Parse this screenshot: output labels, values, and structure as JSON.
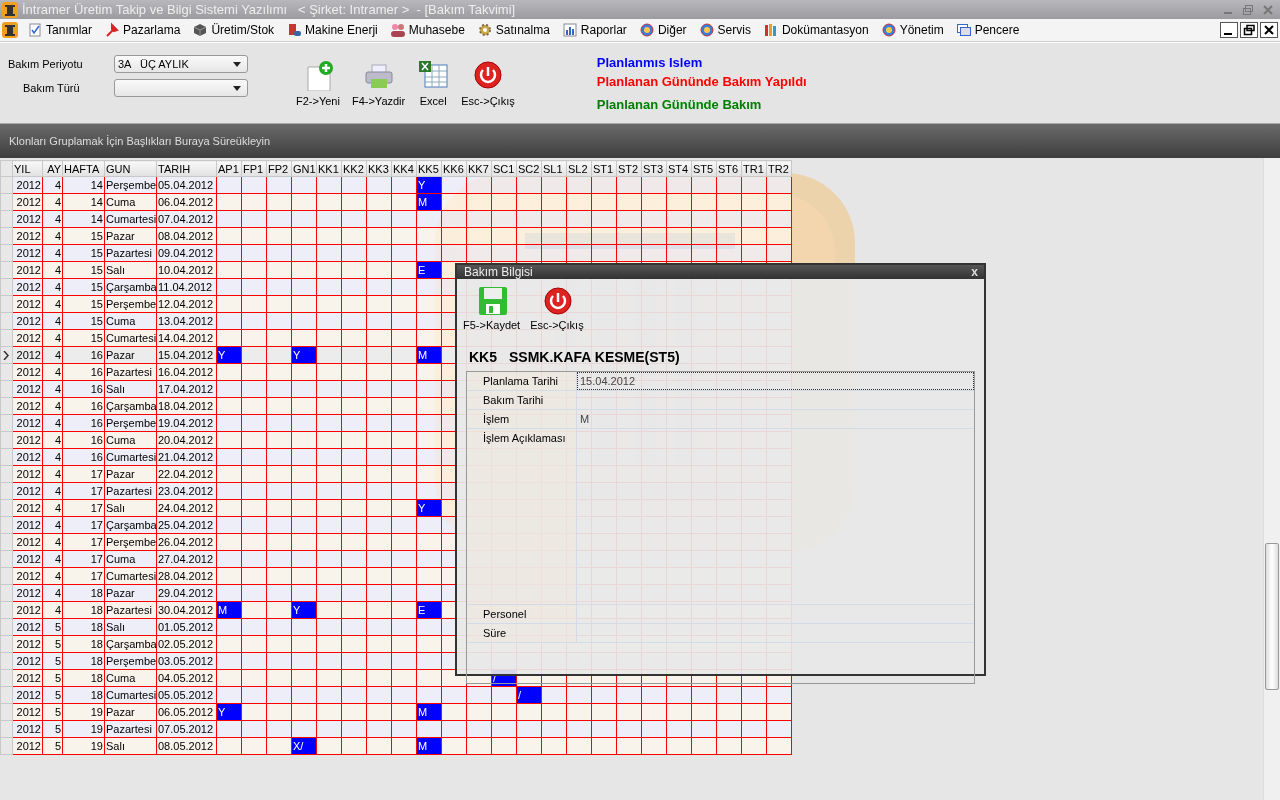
{
  "window": {
    "title": "İntramer Üretim Takip ve Bilgi Sistemi Yazılımı   < Şirket: Intramer >  - [Bakım Takvimi]"
  },
  "menu": [
    {
      "label": "Tanımlar"
    },
    {
      "label": "Pazarlama"
    },
    {
      "label": "Üretim/Stok"
    },
    {
      "label": "Makine Enerji"
    },
    {
      "label": "Muhasebe"
    },
    {
      "label": "Satınalma"
    },
    {
      "label": "Raporlar"
    },
    {
      "label": "Diğer"
    },
    {
      "label": "Servis"
    },
    {
      "label": "Dokümantasyon"
    },
    {
      "label": "Yönetim"
    },
    {
      "label": "Pencere"
    }
  ],
  "filters": [
    {
      "label": "Bakım Periyotu",
      "value": "3A   ÜÇ AYLIK"
    },
    {
      "label": "Bakım Türü"
    }
  ],
  "toolbar": [
    {
      "label": "F2->Yeni",
      "kind": "new"
    },
    {
      "label": "F4->Yazdir",
      "kind": "print"
    },
    {
      "label": "Excel",
      "kind": "excel"
    },
    {
      "label": "Esc->Çıkış",
      "kind": "exit"
    }
  ],
  "legend": [
    {
      "text": "Planlanmıs Islem",
      "color": "#0000ff"
    },
    {
      "text": "Planlanan Gününde Bakım Yapıldı",
      "color": "#ff0000"
    },
    {
      "text": "Planlanan Gününde Bakım",
      "color": "#008000"
    }
  ],
  "group_panel": {
    "text": "Klonları Gruplamak İçin Başlıkları Buraya Süreükleyin"
  },
  "table": {
    "columns": [
      "YIL",
      "AY",
      "HAFTA",
      "GUN",
      "TARIH",
      "AP1",
      "FP1",
      "FP2",
      "GN1",
      "KK1",
      "KK2",
      "KK3",
      "KK4",
      "KK5",
      "KK6",
      "KK7",
      "SC1",
      "SC2",
      "SL1",
      "SL2",
      "ST1",
      "ST2",
      "ST3",
      "ST4",
      "ST5",
      "ST6",
      "TR1",
      "TR2"
    ],
    "rows": [
      {
        "cells": [
          "2012",
          "4",
          "14",
          "Perşembe",
          "05.04.2012",
          null,
          null,
          null,
          null,
          null,
          null,
          null,
          null,
          "Y"
        ],
        "selected": false
      },
      {
        "cells": [
          "2012",
          "4",
          "14",
          "Cuma",
          "06.04.2012",
          null,
          null,
          null,
          null,
          null,
          null,
          null,
          null,
          "M"
        ],
        "selected": false
      },
      {
        "cells": [
          "2012",
          "4",
          "14",
          "Cumartesi",
          "07.04.2012"
        ],
        "selected": false
      },
      {
        "cells": [
          "2012",
          "4",
          "15",
          "Pazar",
          "08.04.2012"
        ],
        "selected": false
      },
      {
        "cells": [
          "2012",
          "4",
          "15",
          "Pazartesi",
          "09.04.2012"
        ],
        "selected": false
      },
      {
        "cells": [
          "2012",
          "4",
          "15",
          "Salı",
          "10.04.2012",
          null,
          null,
          null,
          null,
          null,
          null,
          null,
          null,
          "E"
        ],
        "selected": false
      },
      {
        "cells": [
          "2012",
          "4",
          "15",
          "Çarşamba",
          "11.04.2012"
        ],
        "selected": false
      },
      {
        "cells": [
          "2012",
          "4",
          "15",
          "Perşembe",
          "12.04.2012"
        ],
        "selected": false
      },
      {
        "cells": [
          "2012",
          "4",
          "15",
          "Cuma",
          "13.04.2012"
        ],
        "selected": false
      },
      {
        "cells": [
          "2012",
          "4",
          "15",
          "Cumartesi",
          "14.04.2012"
        ],
        "selected": false
      },
      {
        "cells": [
          "2012",
          "4",
          "16",
          "Pazar",
          "15.04.2012",
          "Y",
          null,
          null,
          "Y",
          null,
          null,
          null,
          null,
          "M"
        ],
        "selected": true
      },
      {
        "cells": [
          "2012",
          "4",
          "16",
          "Pazartesi",
          "16.04.2012"
        ],
        "selected": false
      },
      {
        "cells": [
          "2012",
          "4",
          "16",
          "Salı",
          "17.04.2012"
        ],
        "selected": false
      },
      {
        "cells": [
          "2012",
          "4",
          "16",
          "Çarşamba",
          "18.04.2012"
        ],
        "selected": false
      },
      {
        "cells": [
          "2012",
          "4",
          "16",
          "Perşembe",
          "19.04.2012"
        ],
        "selected": false
      },
      {
        "cells": [
          "2012",
          "4",
          "16",
          "Cuma",
          "20.04.2012"
        ],
        "selected": false
      },
      {
        "cells": [
          "2012",
          "4",
          "16",
          "Cumartesi",
          "21.04.2012"
        ],
        "selected": false
      },
      {
        "cells": [
          "2012",
          "4",
          "17",
          "Pazar",
          "22.04.2012"
        ],
        "selected": false
      },
      {
        "cells": [
          "2012",
          "4",
          "17",
          "Pazartesi",
          "23.04.2012"
        ],
        "selected": false
      },
      {
        "cells": [
          "2012",
          "4",
          "17",
          "Salı",
          "24.04.2012",
          null,
          null,
          null,
          null,
          null,
          null,
          null,
          null,
          "Y"
        ],
        "selected": false
      },
      {
        "cells": [
          "2012",
          "4",
          "17",
          "Çarşamba",
          "25.04.2012"
        ],
        "selected": false
      },
      {
        "cells": [
          "2012",
          "4",
          "17",
          "Perşembe",
          "26.04.2012"
        ],
        "selected": false
      },
      {
        "cells": [
          "2012",
          "4",
          "17",
          "Cuma",
          "27.04.2012"
        ],
        "selected": false
      },
      {
        "cells": [
          "2012",
          "4",
          "17",
          "Cumartesi",
          "28.04.2012"
        ],
        "selected": false
      },
      {
        "cells": [
          "2012",
          "4",
          "18",
          "Pazar",
          "29.04.2012"
        ],
        "selected": false
      },
      {
        "cells": [
          "2012",
          "4",
          "18",
          "Pazartesi",
          "30.04.2012",
          "M",
          null,
          null,
          "Y",
          null,
          null,
          null,
          null,
          "E"
        ],
        "selected": false
      },
      {
        "cells": [
          "2012",
          "5",
          "18",
          "Salı",
          "01.05.2012"
        ],
        "selected": false
      },
      {
        "cells": [
          "2012",
          "5",
          "18",
          "Çarşamba",
          "02.05.2012"
        ],
        "selected": false
      },
      {
        "cells": [
          "2012",
          "5",
          "18",
          "Perşembe",
          "03.05.2012"
        ],
        "selected": false
      },
      {
        "cells": [
          "2012",
          "5",
          "18",
          "Cuma",
          "04.05.2012",
          null,
          null,
          null,
          null,
          null,
          null,
          null,
          null,
          null,
          null,
          null,
          "/"
        ],
        "selected": false
      },
      {
        "cells": [
          "2012",
          "5",
          "18",
          "Cumartesi",
          "05.05.2012",
          null,
          null,
          null,
          null,
          null,
          null,
          null,
          null,
          null,
          null,
          null,
          null,
          "/"
        ],
        "selected": false
      },
      {
        "cells": [
          "2012",
          "5",
          "19",
          "Pazar",
          "06.05.2012",
          "Y",
          null,
          null,
          null,
          null,
          null,
          null,
          null,
          "M"
        ],
        "selected": false
      },
      {
        "cells": [
          "2012",
          "5",
          "19",
          "Pazartesi",
          "07.05.2012"
        ],
        "selected": false
      },
      {
        "cells": [
          "2012",
          "5",
          "19",
          "Salı",
          "08.05.2012",
          null,
          null,
          null,
          "X/",
          null,
          null,
          null,
          null,
          "M"
        ],
        "selected": false
      }
    ]
  },
  "dialog": {
    "title": "Bakım Bilgisi",
    "close": "x",
    "buttons": [
      {
        "label": "F5->Kaydet",
        "kind": "save"
      },
      {
        "label": "Esc->Çıkış",
        "kind": "exit"
      }
    ],
    "heading_code": "KK5",
    "heading_name": "SSMK.KAFA KESME(ST5)",
    "fields": [
      {
        "label": "Planlama Tarihi",
        "value": "15.04.2012",
        "kind": "line",
        "selected": true
      },
      {
        "label": "Bakım Tarihi",
        "kind": "line",
        "selected": false
      },
      {
        "label": "İşlem",
        "value": "M",
        "kind": "line",
        "selected": false
      },
      {
        "label": "İşlem Açıklaması",
        "kind": "memo",
        "selected": false
      },
      {
        "label": "Personel",
        "kind": "line",
        "selected": false
      },
      {
        "label": "Süre",
        "kind": "line",
        "selected": false
      }
    ]
  }
}
